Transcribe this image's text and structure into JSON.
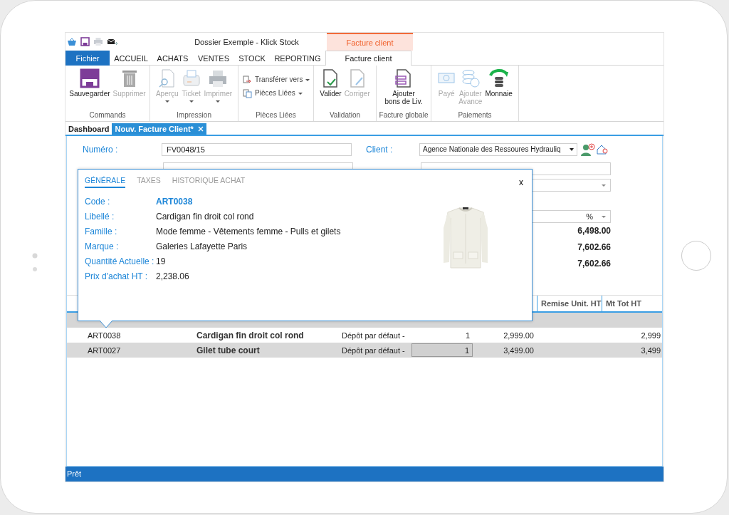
{
  "window": {
    "title": "Dossier Exemple - Klick Stock",
    "context_tab": "Facture client"
  },
  "menu_tabs": [
    {
      "label": "Fichier",
      "kind": "file",
      "selected": false
    },
    {
      "label": "ACCUEIL",
      "kind": "tab",
      "selected": false
    },
    {
      "label": "ACHATS",
      "kind": "tab",
      "selected": false
    },
    {
      "label": "VENTES",
      "kind": "tab",
      "selected": false
    },
    {
      "label": "STOCK",
      "kind": "tab",
      "selected": false
    },
    {
      "label": "REPORTING",
      "kind": "tab",
      "selected": false
    },
    {
      "label": "Facture client",
      "kind": "tab",
      "selected": true
    }
  ],
  "ribbon": [
    {
      "group": "Commands",
      "buttons": [
        {
          "label": "Sauvegarder",
          "kind": "large",
          "disabled": false
        },
        {
          "label": "Supprimer",
          "kind": "large",
          "disabled": true
        }
      ]
    },
    {
      "group": "Impression",
      "buttons": [
        {
          "label": "Aperçu",
          "kind": "large",
          "disabled": true,
          "dropdown": true
        },
        {
          "label": "Ticket",
          "kind": "large",
          "disabled": true,
          "dropdown": true
        },
        {
          "label": "Imprimer",
          "kind": "large",
          "disabled": true,
          "dropdown": true
        }
      ]
    },
    {
      "group": "Pièces Liées",
      "buttons": [
        {
          "label": "Transférer vers",
          "kind": "small",
          "disabled": false,
          "dropdown": true
        },
        {
          "label": "Pièces Liées",
          "kind": "small",
          "disabled": false,
          "dropdown": true
        }
      ]
    },
    {
      "group": "Validation",
      "buttons": [
        {
          "label": "Valider",
          "kind": "large",
          "disabled": false
        },
        {
          "label": "Corriger",
          "kind": "large",
          "disabled": true
        }
      ]
    },
    {
      "group": "Facture globale",
      "buttons": [
        {
          "label": "Ajouter\nbons de Liv.",
          "kind": "large",
          "disabled": false
        }
      ]
    },
    {
      "group": "Paiements",
      "buttons": [
        {
          "label": "Payé",
          "kind": "large",
          "disabled": true
        },
        {
          "label": "Ajouter\nAvance",
          "kind": "large",
          "disabled": true
        },
        {
          "label": "Monnaie",
          "kind": "large",
          "disabled": false
        }
      ]
    }
  ],
  "doc_tabs": [
    {
      "label": "Dashboard",
      "selected": false
    },
    {
      "label": "Nouv. Facture Client*",
      "selected": true,
      "closable": true
    }
  ],
  "form": {
    "numero_label": "Numéro :",
    "numero": "FV0048/15",
    "client_label": "Client :",
    "client": "Agence Nationale des Ressoures Hydrauliq",
    "discount_unit": "%",
    "totals": [
      "6,498.00",
      "7,602.66",
      "7,602.66"
    ]
  },
  "table": {
    "columns": [
      "Remise Unit. HT",
      "Mt Tot HT"
    ],
    "rows": [
      {
        "selected": false,
        "cells": [
          "ART0038",
          "Cardigan fin droit col rond",
          "Dépôt par défaut -",
          "1",
          "2,999.00",
          "2,999"
        ]
      },
      {
        "selected": true,
        "cells": [
          "ART0027",
          "Gilet tube court",
          "Dépôt par défaut -",
          "1",
          "3,499.00",
          "3,499"
        ]
      }
    ]
  },
  "popup": {
    "tabs": [
      {
        "label": "GÉNÉRALE",
        "selected": true
      },
      {
        "label": "TAXES",
        "selected": false
      },
      {
        "label": "HISTORIQUE ACHAT",
        "selected": false
      }
    ],
    "close": "x",
    "fields": [
      {
        "label": "Code :",
        "value": "ART0038",
        "kind": "link"
      },
      {
        "label": "Libellé :",
        "value": "Cardigan fin droit col rond",
        "kind": "text"
      },
      {
        "label": "Famille :",
        "value": "Mode femme - Vêtements femme - Pulls et gilets",
        "kind": "text"
      },
      {
        "label": "Marque :",
        "value": "Galeries Lafayette Paris",
        "kind": "text"
      },
      {
        "label": "Quantité Actuelle :",
        "value": "19",
        "kind": "text"
      },
      {
        "label": "Prix d'achat HT :",
        "value": "2,238.06",
        "kind": "text"
      }
    ]
  },
  "status_bar": "Prêt"
}
